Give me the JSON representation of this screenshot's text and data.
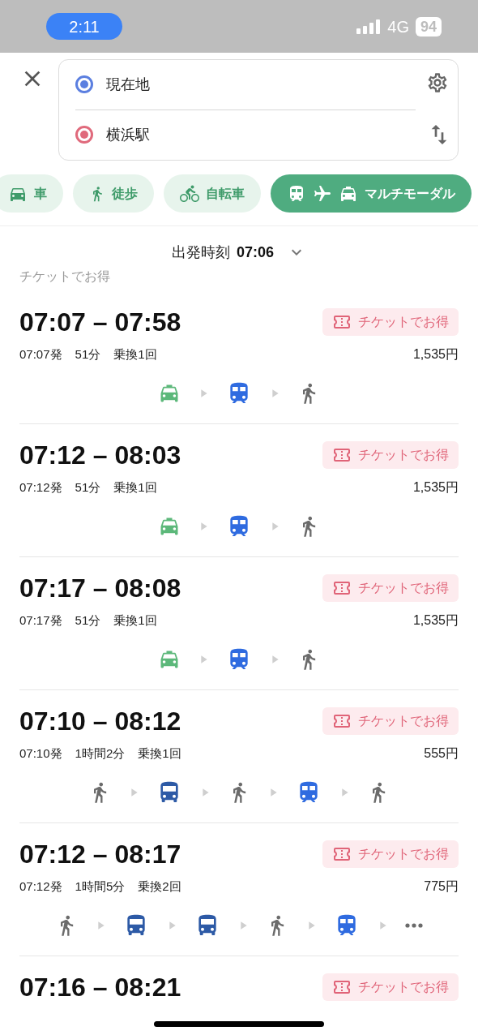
{
  "status_bar": {
    "time": "2:11",
    "network": "4G",
    "battery": "94"
  },
  "search": {
    "origin": "現在地",
    "destination": "横浜駅"
  },
  "modes": [
    {
      "label": "車",
      "kind": "car",
      "selected": false
    },
    {
      "label": "徒歩",
      "kind": "walk",
      "selected": false
    },
    {
      "label": "自転車",
      "kind": "bike",
      "selected": false
    },
    {
      "label": "マルチモーダル",
      "kind": "multimodal",
      "selected": true
    }
  ],
  "departure": {
    "label": "出発時刻",
    "time": "07:06"
  },
  "section_header": "チケットでお得",
  "routes": [
    {
      "time_range": "07:07 – 07:58",
      "depart": "07:07発",
      "duration": "51分",
      "transfers": "乗換1回",
      "fare": "1,535円",
      "badge": "チケットでお得",
      "legs": [
        {
          "kind": "taxi"
        },
        {
          "kind": "train"
        },
        {
          "kind": "walk"
        }
      ]
    },
    {
      "time_range": "07:12 – 08:03",
      "depart": "07:12発",
      "duration": "51分",
      "transfers": "乗換1回",
      "fare": "1,535円",
      "badge": "チケットでお得",
      "legs": [
        {
          "kind": "taxi"
        },
        {
          "kind": "train"
        },
        {
          "kind": "walk"
        }
      ]
    },
    {
      "time_range": "07:17 – 08:08",
      "depart": "07:17発",
      "duration": "51分",
      "transfers": "乗換1回",
      "fare": "1,535円",
      "badge": "チケットでお得",
      "legs": [
        {
          "kind": "taxi"
        },
        {
          "kind": "train"
        },
        {
          "kind": "walk"
        }
      ]
    },
    {
      "time_range": "07:10 – 08:12",
      "depart": "07:10発",
      "duration": "1時間2分",
      "transfers": "乗換1回",
      "fare": "555円",
      "badge": "チケットでお得",
      "legs": [
        {
          "kind": "walk"
        },
        {
          "kind": "bus"
        },
        {
          "kind": "walk"
        },
        {
          "kind": "train"
        },
        {
          "kind": "walk"
        }
      ]
    },
    {
      "time_range": "07:12 – 08:17",
      "depart": "07:12発",
      "duration": "1時間5分",
      "transfers": "乗換2回",
      "fare": "775円",
      "badge": "チケットでお得",
      "legs": [
        {
          "kind": "walk"
        },
        {
          "kind": "bus"
        },
        {
          "kind": "bus"
        },
        {
          "kind": "walk"
        },
        {
          "kind": "train"
        },
        {
          "kind": "more"
        }
      ]
    },
    {
      "time_range": "07:16 – 08:21",
      "badge": "チケットでお得"
    }
  ]
}
